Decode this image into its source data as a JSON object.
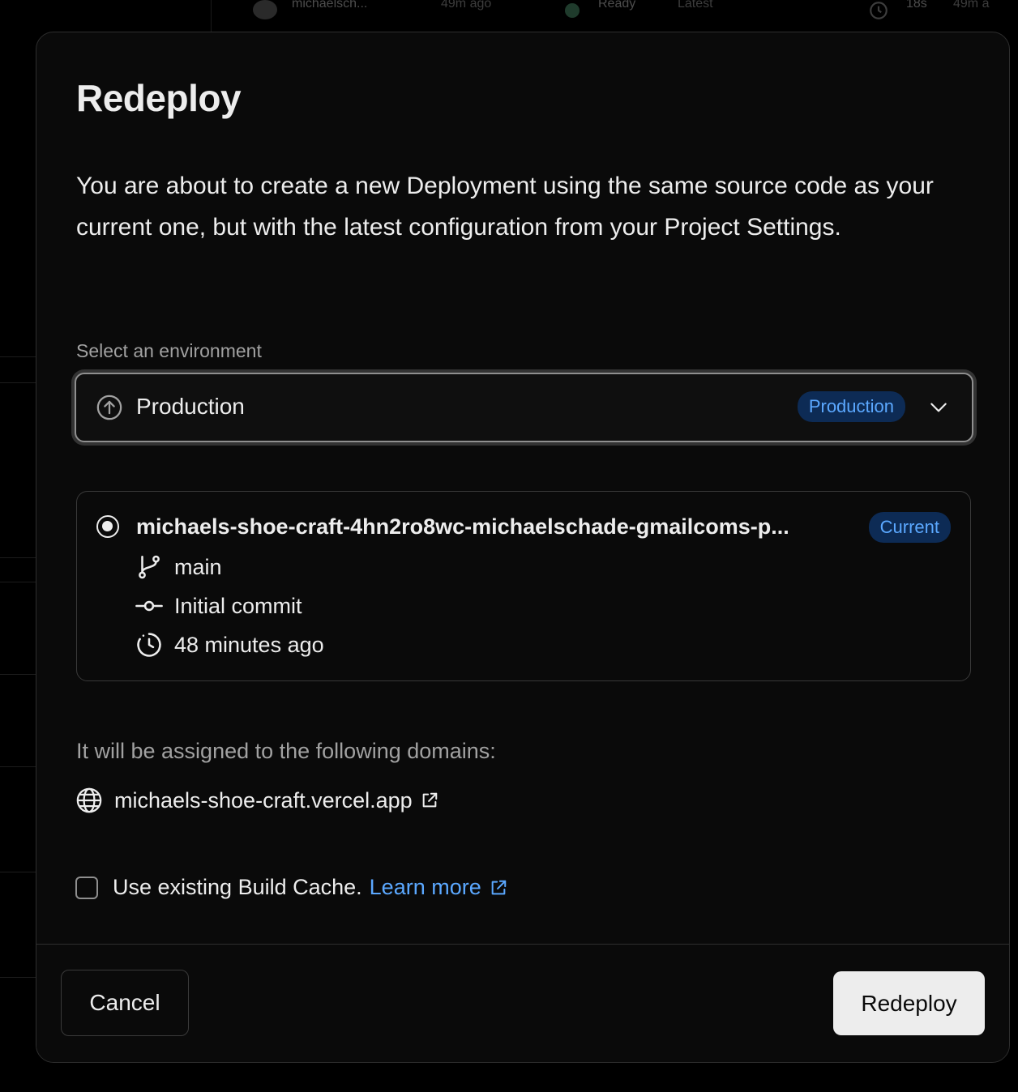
{
  "background": {
    "author": "michaelsch...",
    "age": "49m ago",
    "status": "Ready",
    "tag": "Latest",
    "duration": "18s",
    "age_right": "49m a"
  },
  "modal": {
    "title": "Redeploy",
    "description": "You are about to create a new Deployment using the same source code as your current one, but with the latest configuration from your Project Settings.",
    "environment": {
      "label": "Select an environment",
      "selected": "Production",
      "badge": "Production",
      "icon": "arrow-up-circle-icon"
    },
    "deployment": {
      "name": "michaels-shoe-craft-4hn2ro8wc-michaelschade-gmailcoms-p...",
      "badge": "Current",
      "branch": "main",
      "commit": "Initial commit",
      "time": "48 minutes ago"
    },
    "domains": {
      "label": "It will be assigned to the following domains:",
      "items": [
        "michaels-shoe-craft.vercel.app"
      ]
    },
    "cache": {
      "label": "Use existing Build Cache.",
      "link": "Learn more",
      "checked": false
    },
    "buttons": {
      "cancel": "Cancel",
      "redeploy": "Redeploy"
    }
  },
  "colors": {
    "accent": "#5ba8ff",
    "badge_bg": "#0d2b55",
    "modal_bg": "#0a0a0a"
  }
}
